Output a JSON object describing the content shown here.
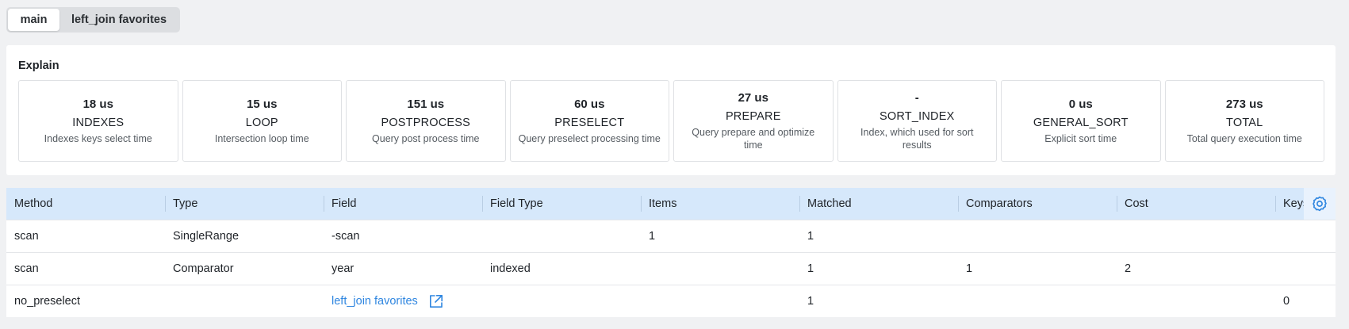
{
  "tabs": [
    {
      "label": "main",
      "active": true
    },
    {
      "label": "left_join favorites",
      "active": false
    }
  ],
  "explain": {
    "title": "Explain",
    "cards": [
      {
        "value": "18 us",
        "name": "INDEXES",
        "desc": "Indexes keys select time"
      },
      {
        "value": "15 us",
        "name": "LOOP",
        "desc": "Intersection loop time"
      },
      {
        "value": "151 us",
        "name": "POSTPROCESS",
        "desc": "Query post process time"
      },
      {
        "value": "60 us",
        "name": "PRESELECT",
        "desc": "Query preselect processing time"
      },
      {
        "value": "27 us",
        "name": "PREPARE",
        "desc": "Query prepare and optimize time"
      },
      {
        "value": "-",
        "name": "SORT_INDEX",
        "desc": "Index, which used for sort results"
      },
      {
        "value": "0 us",
        "name": "GENERAL_SORT",
        "desc": "Explicit sort time"
      },
      {
        "value": "273 us",
        "name": "TOTAL",
        "desc": "Total query execution time"
      }
    ]
  },
  "table": {
    "columns": [
      "Method",
      "Type",
      "Field",
      "Field Type",
      "Items",
      "Matched",
      "Comparators",
      "Cost",
      "Keys"
    ],
    "rows": [
      {
        "method": "scan",
        "type": "SingleRange",
        "field": "-scan",
        "field_type": "",
        "items": "1",
        "matched": "1",
        "comparators": "",
        "cost": "",
        "keys": ""
      },
      {
        "method": "scan",
        "type": "Comparator",
        "field": "year",
        "field_type": "indexed",
        "items": "",
        "matched": "1",
        "comparators": "1",
        "cost": "2",
        "keys": ""
      },
      {
        "method": "no_preselect",
        "type": "",
        "field": "left_join favorites",
        "field_type": "",
        "items": "",
        "matched": "1",
        "comparators": "",
        "cost": "",
        "keys": "0"
      }
    ]
  },
  "icons": {
    "settings": "gear-icon",
    "open_link": "arrow-up-right-icon"
  },
  "colors": {
    "accent": "#2f86e0",
    "header_bg": "#d6e8fb"
  }
}
